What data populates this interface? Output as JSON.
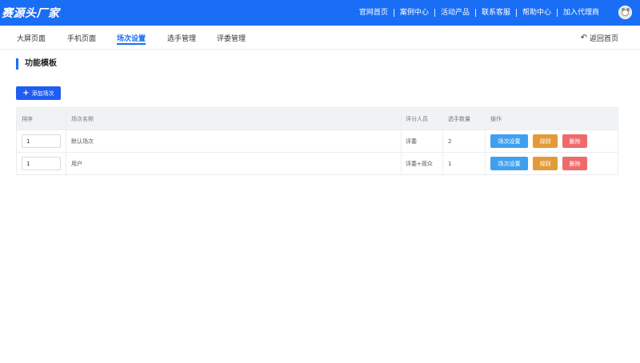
{
  "header": {
    "brand": "赛源头厂家",
    "nav": [
      "官网首页",
      "案例中心",
      "活动产品",
      "联系客服",
      "帮助中心",
      "加入代理商"
    ]
  },
  "subnav": {
    "tabs": [
      "大屏页面",
      "手机页面",
      "场次设置",
      "选手管理",
      "评委管理"
    ],
    "active_tab": "场次设置",
    "back_label": "返回首页"
  },
  "main": {
    "section_title": "功能模板",
    "add_button": "添加场次",
    "table": {
      "columns": [
        "排序",
        "场次名称",
        "评分人员",
        "选手数量",
        "操作"
      ],
      "rows": [
        {
          "order": "1",
          "name": "默认场次",
          "judges": "评委",
          "count": "2"
        },
        {
          "order": "1",
          "name": "用户",
          "judges": "评委+观众",
          "count": "1"
        }
      ],
      "actions": {
        "settings": "场次设置",
        "rules": "规则",
        "delete": "删除"
      }
    }
  },
  "colors": {
    "primary": "#1a6ef5",
    "settings_btn": "#40a0f0",
    "rules_btn": "#e39b3a",
    "delete_btn": "#ee6b6b"
  },
  "icons": {
    "back": "undo-arrow-icon",
    "add": "plus-icon",
    "avatar": "user-avatar"
  }
}
